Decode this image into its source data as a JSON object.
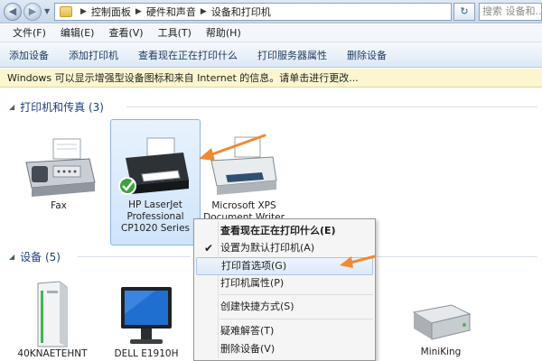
{
  "address_bar": {
    "breadcrumbs": [
      "控制面板",
      "硬件和声音",
      "设备和打印机"
    ],
    "search_placeholder": "搜索 设备和..."
  },
  "menu": [
    "文件(F)",
    "编辑(E)",
    "查看(V)",
    "工具(T)",
    "帮助(H)"
  ],
  "toolbar": [
    "添加设备",
    "添加打印机",
    "查看现在正在打印什么",
    "打印服务器属性",
    "删除设备"
  ],
  "infobar": "Windows 可以显示增强型设备图标和来自 Internet 的信息。请单击进行更改...",
  "printers_group": {
    "title": "打印机和传真 (3)",
    "items": [
      {
        "label": "Fax"
      },
      {
        "label": "HP LaserJet Professional CP1020 Series",
        "lines": [
          "HP LaserJet",
          "Professional",
          "CP1020 Series"
        ],
        "default": true
      },
      {
        "label": "Microsoft XPS Document Writer",
        "lines": [
          "Microsoft XPS",
          "Document Writer"
        ]
      }
    ]
  },
  "devices_group": {
    "title": "设备 (5)",
    "items": [
      {
        "label": "40KNAETEHNT"
      },
      {
        "label": "DELL E1910H"
      },
      {
        "label": "MiniKing"
      }
    ]
  },
  "context_menu": {
    "items": [
      {
        "label": "查看现在正在打印什么(E)",
        "bold": true
      },
      {
        "label": "设置为默认打印机(A)",
        "checked": true
      },
      {
        "label": "打印首选项(G)",
        "highlighted": true
      },
      {
        "label": "打印机属性(P)"
      },
      {
        "label": "创建快捷方式(S)"
      },
      {
        "label": "疑难解答(T)"
      },
      {
        "label": "删除设备(V)"
      }
    ]
  },
  "colors": {
    "annotation_arrow": "#f08a32",
    "group_title": "#1e3f8a",
    "infobar_bg": "#fbf6cf",
    "selection": "#cfe4fb"
  },
  "icons": {
    "default_printer_badge": "green-check-icon",
    "annotation": "orange-arrow-icon"
  }
}
